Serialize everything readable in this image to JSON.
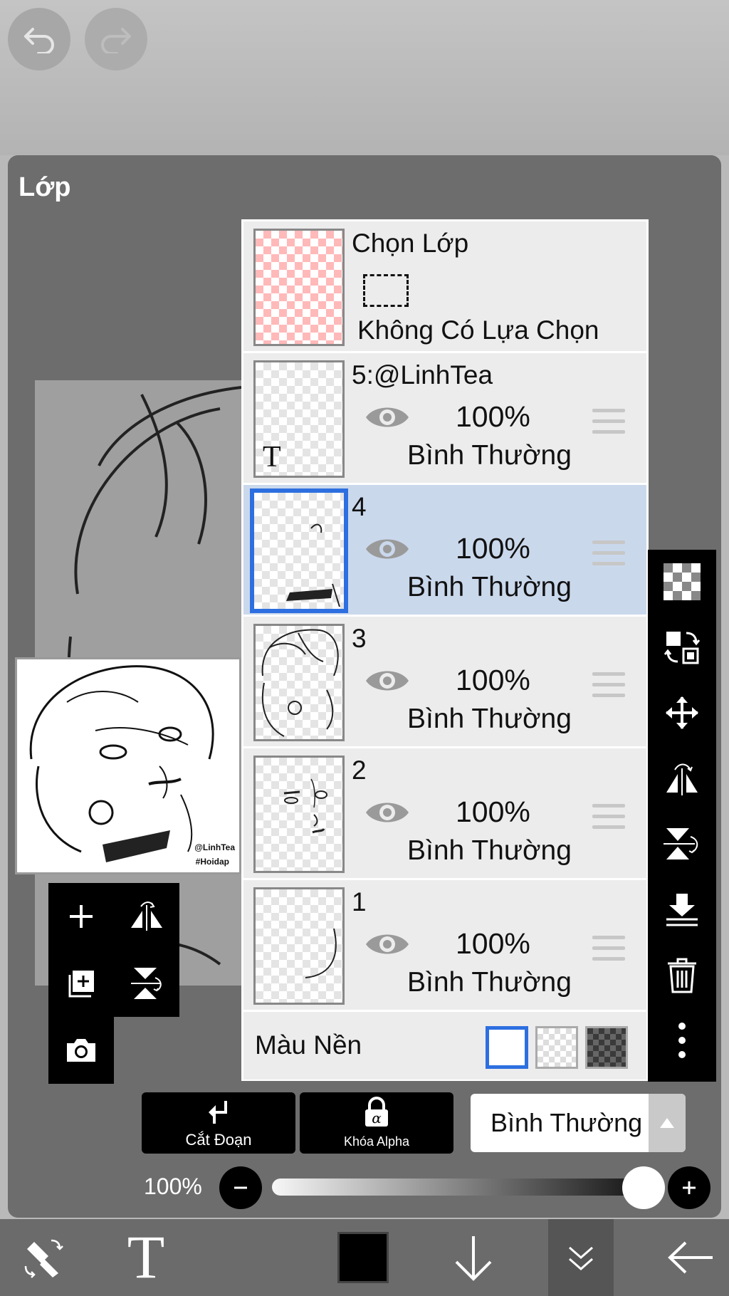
{
  "panel": {
    "title": "Lớp"
  },
  "layers": {
    "selection": {
      "name": "Chọn Lớp",
      "status": "Không Có Lựa Chọn"
    },
    "items": [
      {
        "name": "5:@LinhTea",
        "opacity": "100%",
        "blend": "Bình Thường",
        "thumb_text": "T"
      },
      {
        "name": "4",
        "opacity": "100%",
        "blend": "Bình Thường",
        "selected": true
      },
      {
        "name": "3",
        "opacity": "100%",
        "blend": "Bình Thường"
      },
      {
        "name": "2",
        "opacity": "100%",
        "blend": "Bình Thường"
      },
      {
        "name": "1",
        "opacity": "100%",
        "blend": "Bình Thường"
      }
    ],
    "background": {
      "label": "Màu Nền",
      "selected": "white"
    }
  },
  "preview": {
    "watermark_line1": "@LinhTea",
    "watermark_line2": "#Hoidap"
  },
  "actions": {
    "clipping": "Cắt Đoạn",
    "alpha_lock": "Khóa Alpha",
    "blend_mode": "Bình Thường"
  },
  "opacity_control": {
    "label": "100%",
    "value": 1.0
  },
  "colors": {
    "accent": "#2d6fe0",
    "selected_row": "#cad8ec",
    "panel": "#6d6d6d",
    "current_color": "#000000"
  },
  "icons": {
    "top": [
      "undo-icon",
      "redo-icon"
    ],
    "left_tools": [
      "add-layer-icon",
      "flip-horizontal-icon",
      "add-copy-icon",
      "flip-vertical-icon",
      "camera-icon"
    ],
    "right_tools": [
      "checker-icon",
      "swap-icon",
      "move-icon",
      "flip-h-icon",
      "flip-v-icon",
      "merge-down-icon",
      "trash-icon",
      "more-icon"
    ],
    "bottom": [
      "transform-icon",
      "text-tool-icon",
      "color-swatch",
      "down-arrow-icon",
      "layers-collapse-icon",
      "back-arrow-icon"
    ]
  }
}
